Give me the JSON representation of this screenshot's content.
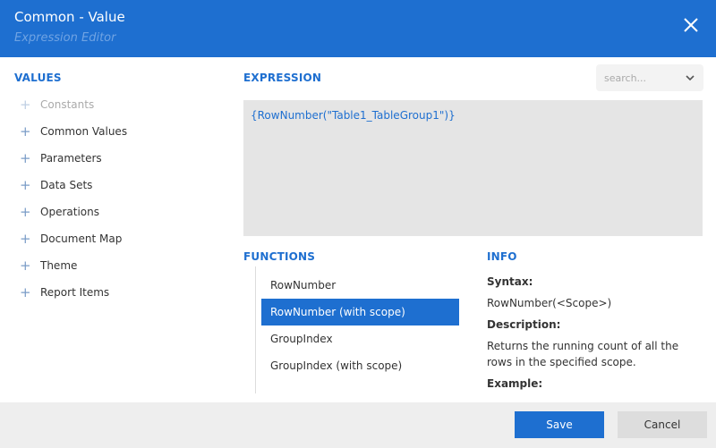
{
  "header": {
    "title": "Common - Value",
    "subtitle": "Expression Editor",
    "close_icon": "close-icon"
  },
  "values": {
    "title": "VALUES",
    "items": [
      {
        "label": "Constants",
        "disabled": true
      },
      {
        "label": "Common Values"
      },
      {
        "label": "Parameters"
      },
      {
        "label": "Data Sets"
      },
      {
        "label": "Operations"
      },
      {
        "label": "Document Map"
      },
      {
        "label": "Theme"
      },
      {
        "label": "Report Items"
      }
    ]
  },
  "expression": {
    "title": "EXPRESSION",
    "text": "{RowNumber(\"Table1_TableGroup1\")}"
  },
  "search": {
    "placeholder": "search..."
  },
  "functions": {
    "title": "FUNCTIONS",
    "items": [
      {
        "label": "RowNumber"
      },
      {
        "label": "RowNumber (with scope)",
        "selected": true
      },
      {
        "label": "GroupIndex"
      },
      {
        "label": "GroupIndex (with scope)"
      }
    ]
  },
  "info": {
    "title": "INFO",
    "syntax_label": "Syntax:",
    "syntax_value": "RowNumber(<Scope>)",
    "description_label": "Description:",
    "description_value": "Returns the running count of all the rows in the specified scope.",
    "example_label": "Example:"
  },
  "footer": {
    "save_label": "Save",
    "cancel_label": "Cancel"
  },
  "colors": {
    "accent": "#1e6fd0",
    "expression_bg": "#e5e5e5",
    "footer_bg": "#eeeeee"
  }
}
